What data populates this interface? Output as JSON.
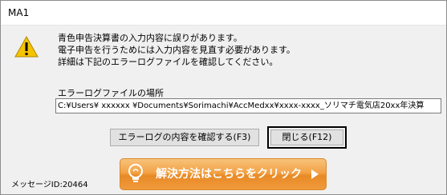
{
  "window": {
    "title": "MA1"
  },
  "message": {
    "lines": [
      "青色申告決算書の入力内容に誤りがあります。",
      "電子申告を行うためには入力内容を見直す必要があります。",
      "詳細は下記のエラーログファイルを確認してください。"
    ]
  },
  "log_location": {
    "label": "エラーログファイルの場所",
    "path": "C:¥Users¥ xxxxxx ¥Documents¥Sorimachi¥AccMedxx¥xxxx-xxxx_ソリマチ電気店20xx年決算"
  },
  "buttons": {
    "confirm_log": "エラーログの内容を確認する(F3)",
    "close": "閉じる(F12)"
  },
  "message_id": "メッセージID:20464",
  "solution": {
    "label": "解決方法はこちらをクリック"
  },
  "icons": {
    "warning": "warning-icon",
    "bulb": "lightbulb-icon",
    "arrow": "arrow-right-icon"
  }
}
